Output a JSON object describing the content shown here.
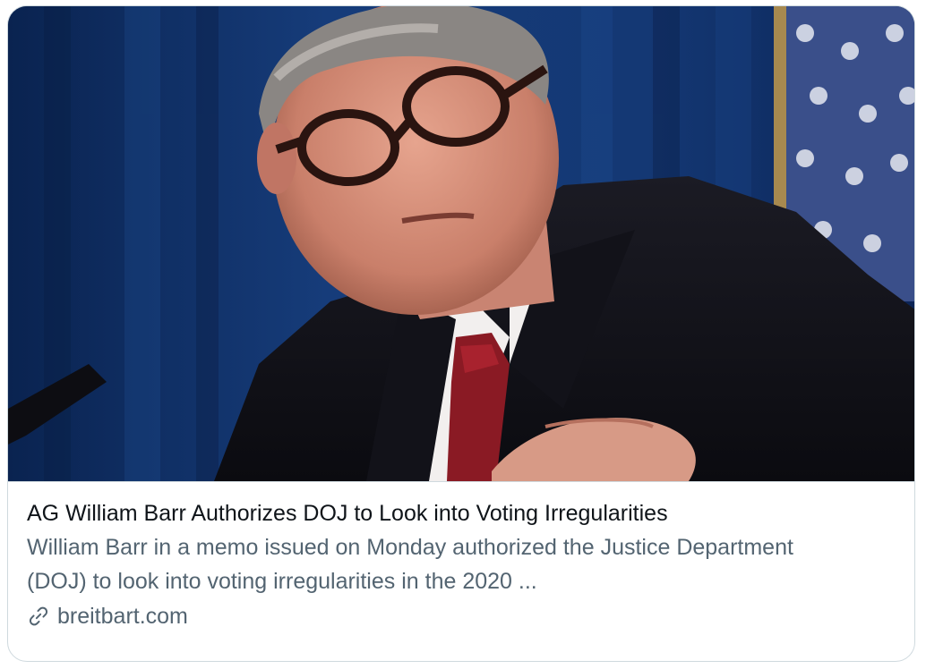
{
  "card": {
    "title": "AG William Barr Authorizes DOJ to Look into Voting Irregularities",
    "description": "William Barr in a memo issued on Monday authorized the Justice Department (DOJ) to look into voting irregularities in the 2020 ...",
    "domain": "breitbart.com",
    "link_icon": "link-icon"
  },
  "colors": {
    "title": "#0f1419",
    "secondary": "#536471",
    "border": "#cfd9de"
  }
}
